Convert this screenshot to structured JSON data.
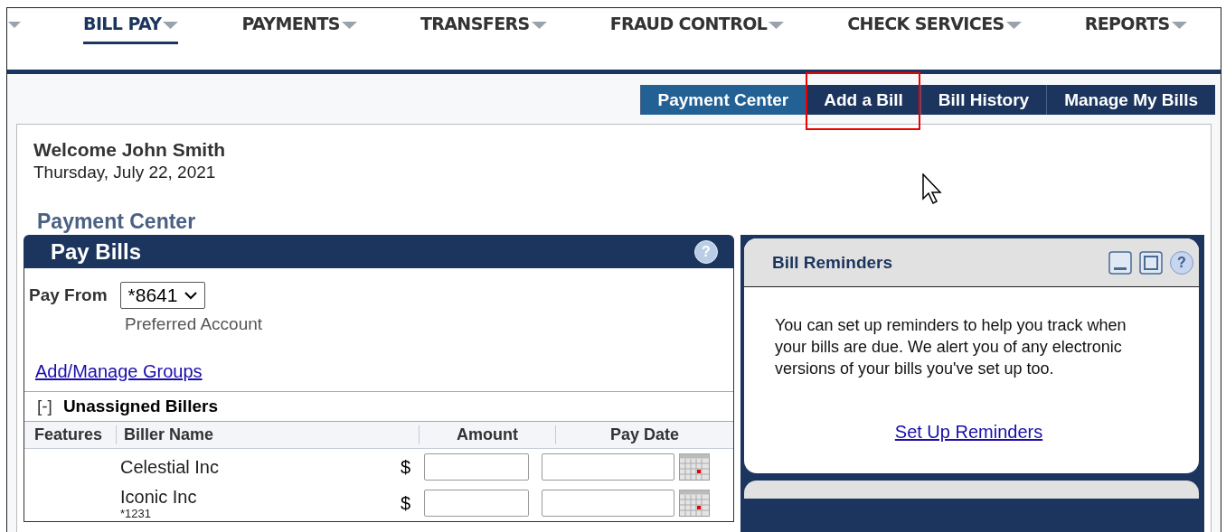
{
  "nav": {
    "items": [
      {
        "label": "BILL PAY",
        "selected": true
      },
      {
        "label": "PAYMENTS",
        "selected": false
      },
      {
        "label": "TRANSFERS",
        "selected": false
      },
      {
        "label": "FRAUD CONTROL",
        "selected": false
      },
      {
        "label": "CHECK SERVICES",
        "selected": false
      },
      {
        "label": "REPORTS",
        "selected": false
      }
    ]
  },
  "subtabs": [
    {
      "label": "Payment Center",
      "selected": true,
      "highlighted": false
    },
    {
      "label": "Add a Bill",
      "selected": false,
      "highlighted": true
    },
    {
      "label": "Bill History",
      "selected": false,
      "highlighted": false
    },
    {
      "label": "Manage My Bills",
      "selected": false,
      "highlighted": false
    }
  ],
  "welcome": {
    "title": "Welcome John Smith",
    "date": "Thursday, July 22, 2021"
  },
  "page_title": "Payment Center",
  "pay_bills": {
    "title": "Pay Bills",
    "help": "?",
    "pay_from_label": "Pay From",
    "account": "*8641",
    "account_note": "Preferred Account",
    "groups_link": "Add/Manage Groups",
    "group": {
      "toggle": "[-]",
      "title": "Unassigned Billers"
    },
    "columns": [
      "Features",
      "Biller Name",
      "Amount",
      "Pay Date"
    ],
    "rows": [
      {
        "name": "Celestial Inc",
        "currency": "$"
      },
      {
        "name": "Iconic Inc",
        "account": "*1231",
        "currency": "$"
      }
    ]
  },
  "reminders": {
    "title": "Bill Reminders",
    "help": "?",
    "text": "You can set up reminders to help you track when your bills are due. We alert you of any electronic versions of your bills you've set up too.",
    "link": "Set Up Reminders"
  }
}
